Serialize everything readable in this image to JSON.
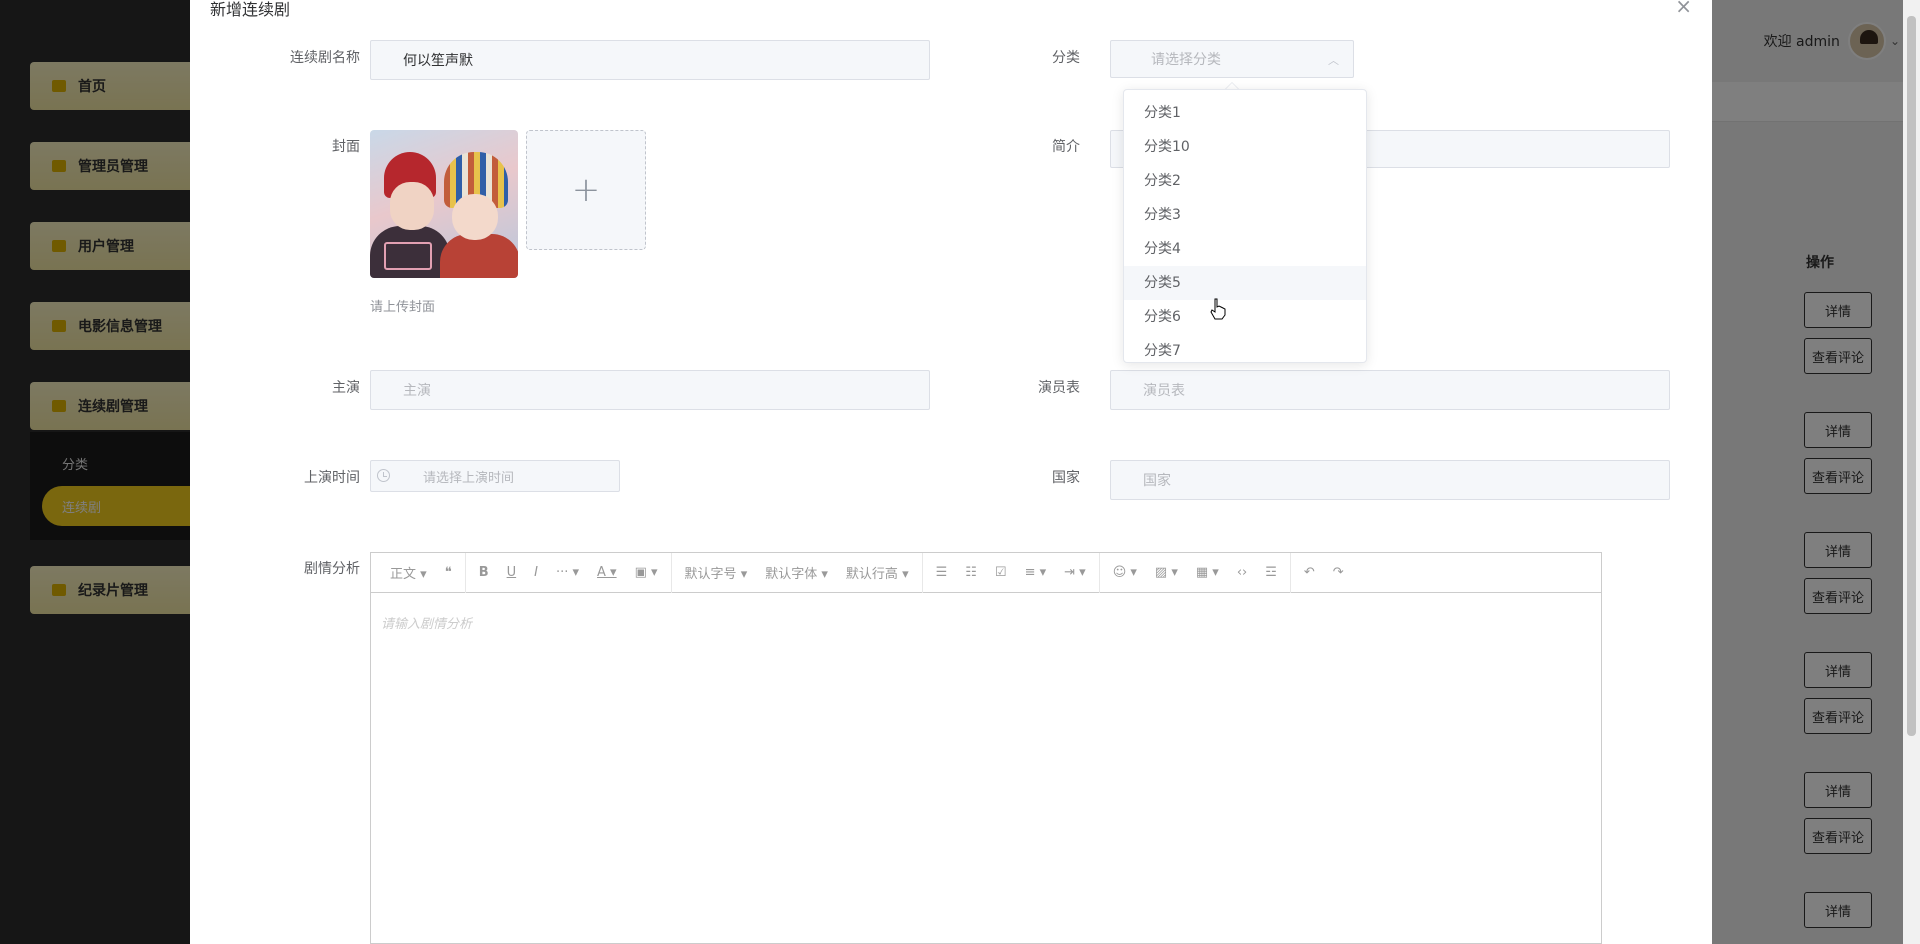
{
  "sidebar": {
    "items": [
      {
        "label": "首页"
      },
      {
        "label": "管理员管理"
      },
      {
        "label": "用户管理"
      },
      {
        "label": "电影信息管理"
      },
      {
        "label": "连续剧管理"
      },
      {
        "label": "纪录片管理"
      }
    ],
    "sub_items": [
      "分类",
      "连续剧"
    ]
  },
  "header": {
    "welcome": "欢迎 admin"
  },
  "table": {
    "op_header": "操作",
    "detail_label": "详情",
    "comments_label": "查看评论"
  },
  "dialog": {
    "title": "新增连续剧",
    "fields": {
      "name": {
        "label": "连续剧名称",
        "value": "何以笙声默"
      },
      "category": {
        "label": "分类",
        "placeholder": "请选择分类"
      },
      "cover": {
        "label": "封面",
        "hint": "请上传封面"
      },
      "intro": {
        "label": "简介"
      },
      "lead": {
        "label": "主演",
        "placeholder": "主演"
      },
      "cast": {
        "label": "演员表",
        "placeholder": "演员表"
      },
      "release": {
        "label": "上演时间",
        "placeholder": "请选择上演时间"
      },
      "country": {
        "label": "国家",
        "placeholder": "国家"
      },
      "analysis": {
        "label": "剧情分析",
        "placeholder": "请输入剧情分析"
      }
    },
    "category_options": [
      "分类1",
      "分类10",
      "分类2",
      "分类3",
      "分类4",
      "分类5",
      "分类6",
      "分类7"
    ],
    "hovered_option": "分类5"
  },
  "editor_toolbar": {
    "paragraph": "正文",
    "font_size": "默认字号",
    "font_family": "默认字体",
    "line_height": "默认行高"
  }
}
